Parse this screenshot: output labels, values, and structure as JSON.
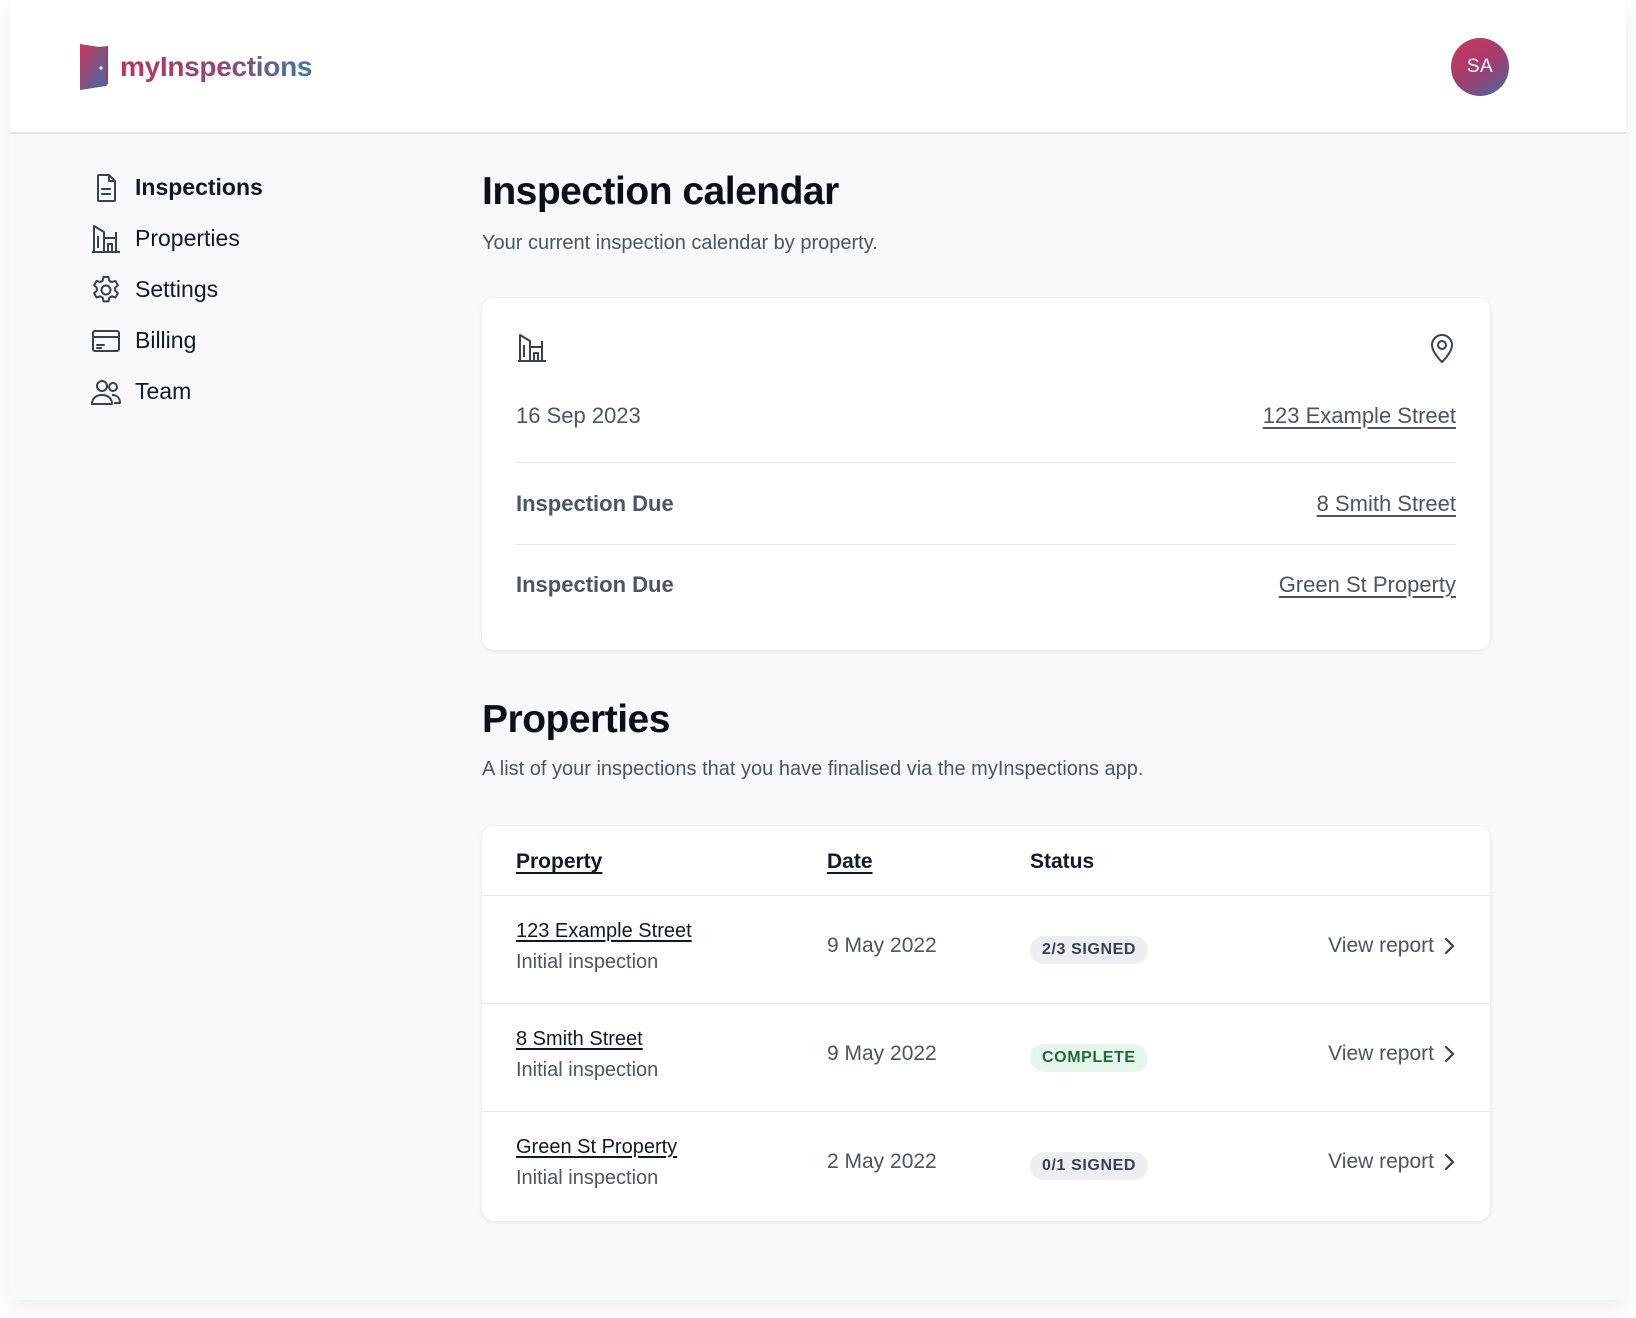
{
  "brand": {
    "name": "myInspections",
    "avatar_initials": "SA",
    "colors": {
      "primary": "#c2305a",
      "secondary": "#3a78a8"
    }
  },
  "sidebar": {
    "items": [
      {
        "label": "Inspections",
        "icon": "document-icon",
        "active": true
      },
      {
        "label": "Properties",
        "icon": "building-icon"
      },
      {
        "label": "Settings",
        "icon": "gear-icon"
      },
      {
        "label": "Billing",
        "icon": "credit-card-icon"
      },
      {
        "label": "Team",
        "icon": "users-icon"
      }
    ]
  },
  "calendar": {
    "title": "Inspection calendar",
    "subtitle": "Your current inspection calendar by property.",
    "rows": [
      {
        "left": "16 Sep 2023",
        "right": "123 Example Street"
      },
      {
        "left": "Inspection Due",
        "right": "8 Smith Street"
      },
      {
        "left": "Inspection Due",
        "right": "Green St Property"
      }
    ]
  },
  "properties": {
    "title": "Properties",
    "subtitle": "A list of your inspections that you have finalised via the myInspections app.",
    "columns": [
      "Property",
      "Date",
      "Status"
    ],
    "action_label": "View report",
    "rows": [
      {
        "property": "123 Example Street",
        "type": "Initial inspection",
        "date": "9 May 2022",
        "status": "2/3 SIGNED",
        "status_color": "#374151"
      },
      {
        "property": "8 Smith Street",
        "type": "Initial inspection",
        "date": "9 May 2022",
        "status": "COMPLETE",
        "status_color": "#1e6b3a"
      },
      {
        "property": "Green St Property",
        "type": "Initial inspection",
        "date": "2 May 2022",
        "status": "0/1 SIGNED",
        "status_color": "#374151"
      }
    ]
  }
}
